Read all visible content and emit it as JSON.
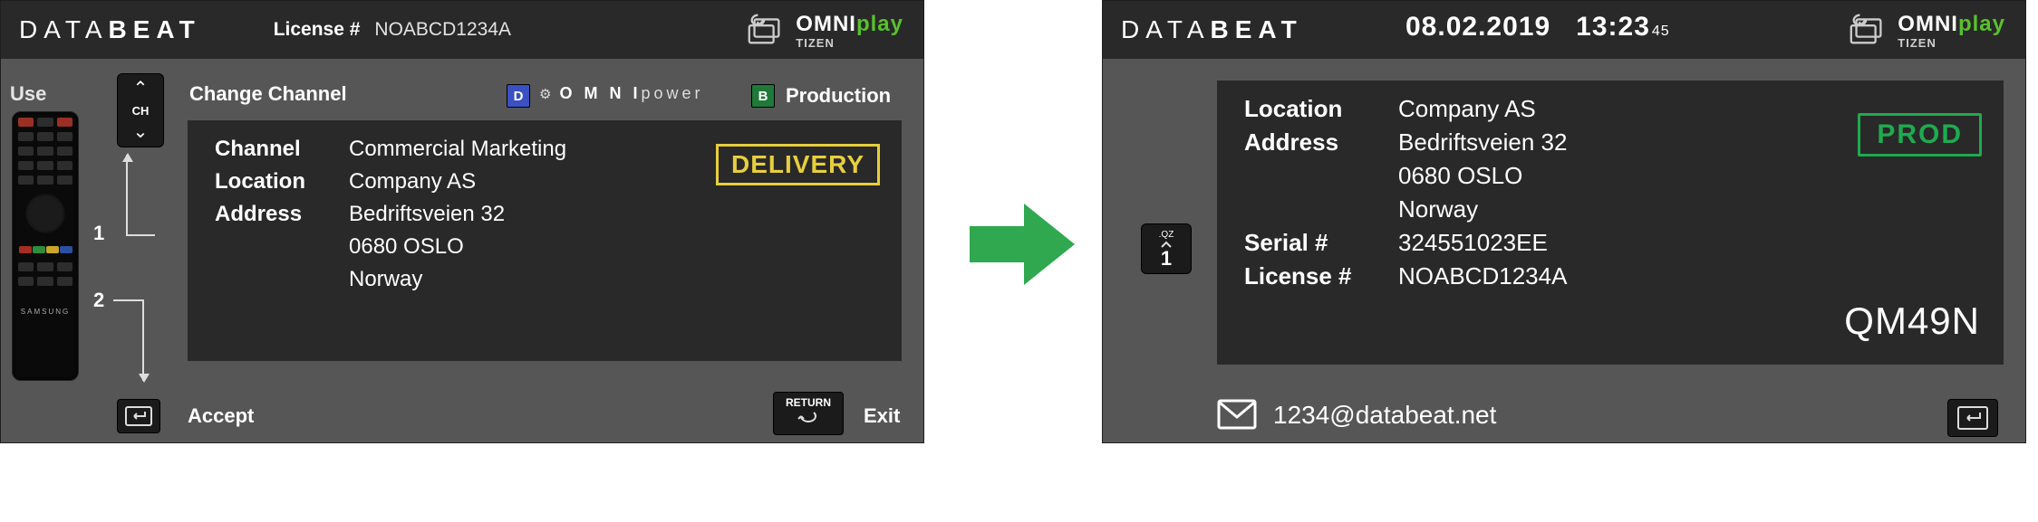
{
  "brand": {
    "pre": "DATA",
    "post": "BEAT"
  },
  "omni": {
    "main": "OMNI",
    "play": "play",
    "sub": "TIZEN"
  },
  "left": {
    "license_label": "License #",
    "license_value": "NOABCD1234A",
    "use_label": "Use",
    "ch_label": "CH",
    "step1": "1",
    "step2": "2",
    "change_channel": "Change Channel",
    "badge_d": "D",
    "omnipower_pre": "O M N I",
    "omnipower_post": "power",
    "badge_b": "B",
    "production": "Production",
    "info": {
      "channel_k": "Channel",
      "channel_v": "Commercial Marketing",
      "location_k": "Location",
      "location_v": "Company AS",
      "address_k": "Address",
      "address_l1": "Bedriftsveien 32",
      "address_l2": "0680 OSLO",
      "address_l3": "Norway"
    },
    "delivery": "DELIVERY",
    "accept": "Accept",
    "return": "RETURN",
    "exit": "Exit"
  },
  "right": {
    "date": "08.02.2019",
    "time": "13:23",
    "time_sec": "45",
    "key_qz_top": ".QZ",
    "key_qz_num": "1",
    "info": {
      "location_k": "Location",
      "location_v": "Company AS",
      "address_k": "Address",
      "address_l1": "Bedriftsveien 32",
      "address_l2": "0680 OSLO",
      "address_l3": "Norway",
      "serial_k": "Serial #",
      "serial_v": "324551023EE",
      "license_k": "License #",
      "license_v": "NOABCD1234A"
    },
    "prod_chip": "PROD",
    "model": "QM49N",
    "email": "1234@databeat.net"
  }
}
